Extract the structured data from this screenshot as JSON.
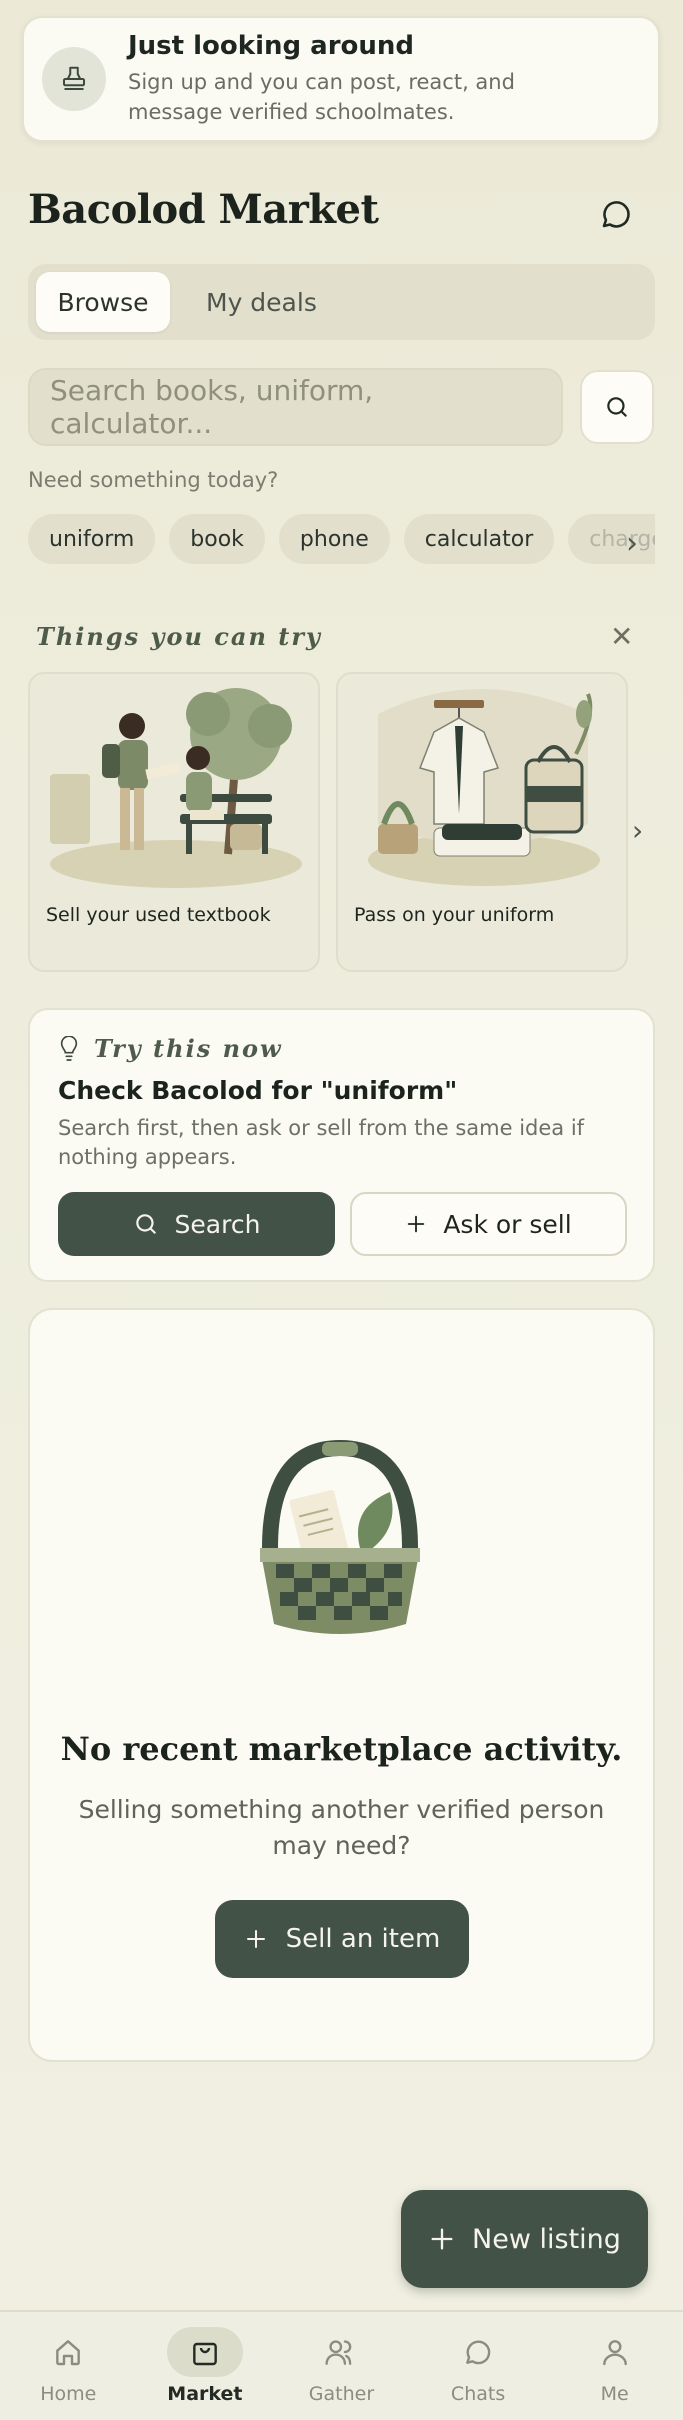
{
  "guest_banner": {
    "title": "Just looking around",
    "subtitle": "Sign up and you can post, react, and message verified schoolmates.",
    "icon": "stamp-icon"
  },
  "header": {
    "title": "Bacolod Market",
    "chat_icon": "chat-bubble-icon"
  },
  "tabs": [
    {
      "label": "Browse",
      "active": true
    },
    {
      "label": "My deals",
      "active": false
    }
  ],
  "search": {
    "placeholder": "Search books, uniform, calculator...",
    "icon": "search-icon"
  },
  "suggestions": {
    "label": "Need something today?",
    "chips": [
      "uniform",
      "book",
      "phone",
      "calculator",
      "charger"
    ]
  },
  "things_to_try": {
    "heading": "Things you can try",
    "cards": [
      {
        "label": "Sell your used textbook"
      },
      {
        "label": "Pass on your uniform"
      }
    ]
  },
  "try_now": {
    "heading": "Try this now",
    "title": "Check Bacolod for \"uniform\"",
    "description": "Search first, then ask or sell from the same idea if nothing appears.",
    "search_label": "Search",
    "ask_label": "Ask or sell"
  },
  "empty_state": {
    "title": "No recent marketplace activity.",
    "subtitle": "Selling something another verified person may need?",
    "button_label": "Sell an item"
  },
  "fab": {
    "label": "New listing"
  },
  "bottom_nav": [
    {
      "label": "Home",
      "icon": "home-icon",
      "active": false
    },
    {
      "label": "Market",
      "icon": "shopping-bag-icon",
      "active": true
    },
    {
      "label": "Gather",
      "icon": "people-icon",
      "active": false
    },
    {
      "label": "Chats",
      "icon": "chat-bubble-icon",
      "active": false
    },
    {
      "label": "Me",
      "icon": "person-icon",
      "active": false
    }
  ],
  "colors": {
    "accent": "#425246",
    "background": "#eceadb",
    "card": "#fbfaf3"
  }
}
